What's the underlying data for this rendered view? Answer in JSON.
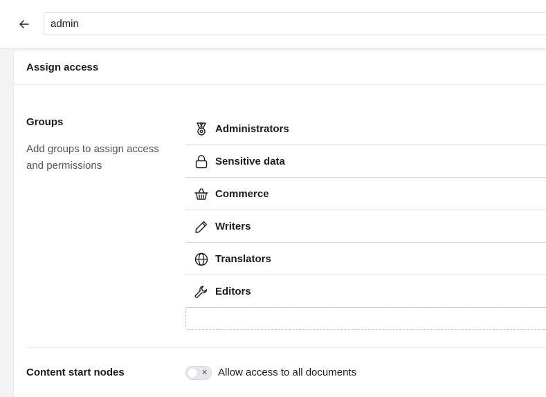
{
  "header": {
    "name_value": "admin"
  },
  "panel": {
    "title": "Assign access",
    "groups_section": {
      "title": "Groups",
      "description": "Add groups to assign access and permissions",
      "items": [
        {
          "label": "Administrators",
          "icon": "medal-icon"
        },
        {
          "label": "Sensitive data",
          "icon": "lock-icon"
        },
        {
          "label": "Commerce",
          "icon": "basket-icon"
        },
        {
          "label": "Writers",
          "icon": "pencil-icon"
        },
        {
          "label": "Translators",
          "icon": "globe-icon"
        },
        {
          "label": "Editors",
          "icon": "wrench-icon"
        }
      ]
    },
    "start_nodes_section": {
      "title": "Content start nodes",
      "toggle_label": "Allow access to all documents",
      "toggle_on": false
    }
  }
}
